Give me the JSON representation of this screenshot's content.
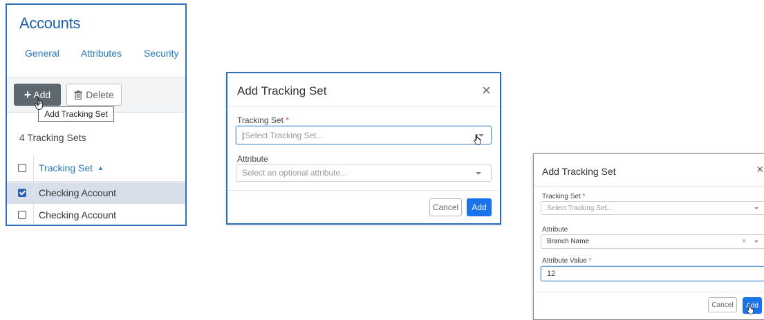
{
  "accounts": {
    "title": "Accounts",
    "tabs": [
      "General",
      "Attributes",
      "Security"
    ],
    "add_label": "Add",
    "delete_label": "Delete",
    "tooltip": "Add Tracking Set",
    "count_text": "4 Tracking Sets",
    "column_header": "Tracking Set",
    "rows": [
      {
        "label": "Checking Account",
        "checked": true
      },
      {
        "label": "Checking Account",
        "checked": false
      }
    ]
  },
  "dialog_empty": {
    "title": "Add Tracking Set",
    "tracking_set_label": "Tracking Set",
    "required_mark": "*",
    "tracking_set_placeholder": "Select Tracking Set...",
    "attribute_label": "Attribute",
    "attribute_placeholder": "Select an optional attribute...",
    "cancel_label": "Cancel",
    "add_label": "Add"
  },
  "dialog_filled": {
    "title": "Add Tracking Set",
    "tracking_set_label": "Tracking Set",
    "required_mark": "*",
    "tracking_set_placeholder": "Select Tracking Set...",
    "attribute_label": "Attribute",
    "attribute_value_selected": "Branch Name",
    "attribute_value_label": "Attribute Value",
    "attribute_value_input": "12",
    "cancel_label": "Cancel",
    "add_label": "Add"
  },
  "colors": {
    "accent_blue": "#1a73e8",
    "title_blue": "#1f5fa8",
    "link_blue": "#2a7ab8",
    "required_red": "#d9534f",
    "add_button_gray": "#5c6770",
    "selected_row": "#d7e0ea"
  },
  "icons": [
    "plus-icon",
    "trash-icon",
    "sort-up-icon",
    "close-icon",
    "chevron-down-icon",
    "hand-cursor-icon"
  ]
}
